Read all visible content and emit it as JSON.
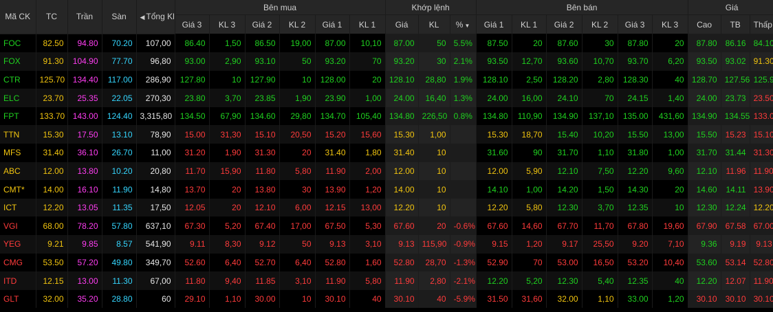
{
  "colors": {
    "up": "#1fd11f",
    "down": "#ff3b3b",
    "ref": "#f1c40f",
    "ceil": "#ff3df2",
    "floor": "#35d6ff",
    "neutral": "#e6e6e6"
  },
  "header": {
    "groups": {
      "buy": "Bên mua",
      "match": "Khớp lệnh",
      "sell": "Bên bán",
      "price": "Giá"
    },
    "cols": {
      "symbol": "Mã CK",
      "ref": "TC",
      "ceil": "Trần",
      "floor": "Sàn",
      "total": "Tổng Kl",
      "buy": [
        "Giá 3",
        "KL 3",
        "Giá 2",
        "KL 2",
        "Giá 1",
        "KL 1"
      ],
      "match": [
        "Giá",
        "KL",
        "%"
      ],
      "sell": [
        "Giá 1",
        "KL 1",
        "Giá 2",
        "KL 2",
        "Giá 3",
        "KL 3"
      ],
      "price": [
        "Cao",
        "TB",
        "Thấp"
      ]
    }
  },
  "rows": [
    {
      "sym": "FOC",
      "ref": "82.50",
      "ceil": "94.80",
      "floor": "70.20",
      "total": "107,00",
      "b3p": "86.40",
      "b3v": "1,50",
      "b2p": "86.50",
      "b2v": "19,00",
      "b1p": "87.00",
      "b1v": "10,10",
      "mp": "87.00",
      "mv": "50",
      "pct": "5.5%",
      "s1p": "87.50",
      "s1v": "20",
      "s2p": "87.60",
      "s2v": "30",
      "s3p": "87.80",
      "s3v": "20",
      "hi": "87.80",
      "avg": "86.16",
      "lo": "84.10",
      "c": {
        "sym": "u",
        "b3": "u",
        "b2": "u",
        "b1": "u",
        "m": "u",
        "s1": "u",
        "s2": "u",
        "s3": "u",
        "hi": "u",
        "avg": "u",
        "lo": "u"
      }
    },
    {
      "sym": "FOX",
      "ref": "91.30",
      "ceil": "104.90",
      "floor": "77.70",
      "total": "96,80",
      "b3p": "93.00",
      "b3v": "2,90",
      "b2p": "93.10",
      "b2v": "50",
      "b1p": "93.20",
      "b1v": "70",
      "mp": "93.20",
      "mv": "30",
      "pct": "2.1%",
      "s1p": "93.50",
      "s1v": "12,70",
      "s2p": "93.60",
      "s2v": "10,70",
      "s3p": "93.70",
      "s3v": "6,20",
      "hi": "93.50",
      "avg": "93.02",
      "lo": "91.30",
      "c": {
        "sym": "u",
        "b3": "u",
        "b2": "u",
        "b1": "u",
        "m": "u",
        "s1": "u",
        "s2": "u",
        "s3": "u",
        "hi": "u",
        "avg": "u",
        "lo": "r"
      }
    },
    {
      "sym": "CTR",
      "ref": "125.70",
      "ceil": "134.40",
      "floor": "117.00",
      "total": "286,90",
      "b3p": "127.80",
      "b3v": "10",
      "b2p": "127.90",
      "b2v": "10",
      "b1p": "128.00",
      "b1v": "20",
      "mp": "128.10",
      "mv": "28,80",
      "pct": "1.9%",
      "s1p": "128.10",
      "s1v": "2,50",
      "s2p": "128.20",
      "s2v": "2,80",
      "s3p": "128.30",
      "s3v": "40",
      "hi": "128.70",
      "avg": "127.56",
      "lo": "125.90",
      "c": {
        "sym": "u",
        "b3": "u",
        "b2": "u",
        "b1": "u",
        "m": "u",
        "s1": "u",
        "s2": "u",
        "s3": "u",
        "hi": "u",
        "avg": "u",
        "lo": "u"
      }
    },
    {
      "sym": "ELC",
      "ref": "23.70",
      "ceil": "25.35",
      "floor": "22.05",
      "total": "270,30",
      "b3p": "23.80",
      "b3v": "3,70",
      "b2p": "23.85",
      "b2v": "1,90",
      "b1p": "23.90",
      "b1v": "1,00",
      "mp": "24.00",
      "mv": "16,40",
      "pct": "1.3%",
      "s1p": "24.00",
      "s1v": "16,00",
      "s2p": "24.10",
      "s2v": "70",
      "s3p": "24.15",
      "s3v": "1,40",
      "hi": "24.00",
      "avg": "23.73",
      "lo": "23.50",
      "c": {
        "sym": "u",
        "b3": "u",
        "b2": "u",
        "b1": "u",
        "m": "u",
        "s1": "u",
        "s2": "u",
        "s3": "u",
        "hi": "u",
        "avg": "u",
        "lo": "d"
      }
    },
    {
      "sym": "FPT",
      "ref": "133.70",
      "ceil": "143.00",
      "floor": "124.40",
      "total": "3,315,80",
      "b3p": "134.50",
      "b3v": "67,90",
      "b2p": "134.60",
      "b2v": "29,80",
      "b1p": "134.70",
      "b1v": "105,40",
      "mp": "134.80",
      "mv": "226,50",
      "pct": "0.8%",
      "s1p": "134.80",
      "s1v": "110,90",
      "s2p": "134.90",
      "s2v": "137,10",
      "s3p": "135.00",
      "s3v": "431,60",
      "hi": "134.90",
      "avg": "134.55",
      "lo": "133.00",
      "c": {
        "sym": "u",
        "b3": "u",
        "b2": "u",
        "b1": "u",
        "m": "u",
        "s1": "u",
        "s2": "u",
        "s3": "u",
        "hi": "u",
        "avg": "u",
        "lo": "d"
      }
    },
    {
      "sym": "TTN",
      "ref": "15.30",
      "ceil": "17.50",
      "floor": "13.10",
      "total": "78,90",
      "b3p": "15.00",
      "b3v": "31,30",
      "b2p": "15.10",
      "b2v": "20,50",
      "b1p": "15.20",
      "b1v": "15,60",
      "mp": "15.30",
      "mv": "1,00",
      "pct": "",
      "s1p": "15.30",
      "s1v": "18,70",
      "s2p": "15.40",
      "s2v": "10,20",
      "s3p": "15.50",
      "s3v": "13,00",
      "hi": "15.50",
      "avg": "15.23",
      "lo": "15.10",
      "c": {
        "sym": "r",
        "b3": "d",
        "b2": "d",
        "b1": "d",
        "m": "r",
        "s1": "r",
        "s2": "u",
        "s3": "u",
        "hi": "u",
        "avg": "d",
        "lo": "d"
      }
    },
    {
      "sym": "MFS",
      "ref": "31.40",
      "ceil": "36.10",
      "floor": "26.70",
      "total": "11,00",
      "b3p": "31.20",
      "b3v": "1,90",
      "b2p": "31.30",
      "b2v": "20",
      "b1p": "31.40",
      "b1v": "1,80",
      "mp": "31.40",
      "mv": "10",
      "pct": "",
      "s1p": "31.60",
      "s1v": "90",
      "s2p": "31.70",
      "s2v": "1,10",
      "s3p": "31.80",
      "s3v": "1,00",
      "hi": "31.70",
      "avg": "31.44",
      "lo": "31.30",
      "c": {
        "sym": "r",
        "b3": "d",
        "b2": "d",
        "b1": "r",
        "m": "r",
        "s1": "u",
        "s2": "u",
        "s3": "u",
        "hi": "u",
        "avg": "u",
        "lo": "d"
      }
    },
    {
      "sym": "ABC",
      "ref": "12.00",
      "ceil": "13.80",
      "floor": "10.20",
      "total": "20,80",
      "b3p": "11.70",
      "b3v": "15,90",
      "b2p": "11.80",
      "b2v": "5,80",
      "b1p": "11.90",
      "b1v": "2,00",
      "mp": "12.00",
      "mv": "10",
      "pct": "",
      "s1p": "12.00",
      "s1v": "5,90",
      "s2p": "12.10",
      "s2v": "7,50",
      "s3p": "12.20",
      "s3v": "9,60",
      "hi": "12.10",
      "avg": "11.96",
      "lo": "11.90",
      "c": {
        "sym": "r",
        "b3": "d",
        "b2": "d",
        "b1": "d",
        "m": "r",
        "s1": "r",
        "s2": "u",
        "s3": "u",
        "hi": "u",
        "avg": "d",
        "lo": "d"
      }
    },
    {
      "sym": "CMT*",
      "ref": "14.00",
      "ceil": "16.10",
      "floor": "11.90",
      "total": "14,80",
      "b3p": "13.70",
      "b3v": "20",
      "b2p": "13.80",
      "b2v": "30",
      "b1p": "13.90",
      "b1v": "1,20",
      "mp": "14.00",
      "mv": "10",
      "pct": "",
      "s1p": "14.10",
      "s1v": "1,00",
      "s2p": "14.20",
      "s2v": "1,50",
      "s3p": "14.30",
      "s3v": "20",
      "hi": "14.60",
      "avg": "14.11",
      "lo": "13.90",
      "c": {
        "sym": "r",
        "b3": "d",
        "b2": "d",
        "b1": "d",
        "m": "r",
        "s1": "u",
        "s2": "u",
        "s3": "u",
        "hi": "u",
        "avg": "u",
        "lo": "d"
      }
    },
    {
      "sym": "ICT",
      "ref": "12.20",
      "ceil": "13.05",
      "floor": "11.35",
      "total": "17,50",
      "b3p": "12.05",
      "b3v": "20",
      "b2p": "12.10",
      "b2v": "6,00",
      "b1p": "12.15",
      "b1v": "13,00",
      "mp": "12.20",
      "mv": "10",
      "pct": "",
      "s1p": "12.20",
      "s1v": "5,80",
      "s2p": "12.30",
      "s2v": "3,70",
      "s3p": "12.35",
      "s3v": "10",
      "hi": "12.30",
      "avg": "12.24",
      "lo": "12.20",
      "c": {
        "sym": "r",
        "b3": "d",
        "b2": "d",
        "b1": "d",
        "m": "r",
        "s1": "r",
        "s2": "u",
        "s3": "u",
        "hi": "u",
        "avg": "u",
        "lo": "r"
      }
    },
    {
      "sym": "VGI",
      "ref": "68.00",
      "ceil": "78.20",
      "floor": "57.80",
      "total": "637,10",
      "b3p": "67.30",
      "b3v": "5,20",
      "b2p": "67.40",
      "b2v": "17,00",
      "b1p": "67.50",
      "b1v": "5,30",
      "mp": "67.60",
      "mv": "20",
      "pct": "-0.6%",
      "s1p": "67.60",
      "s1v": "14,60",
      "s2p": "67.70",
      "s2v": "11,70",
      "s3p": "67.80",
      "s3v": "19,60",
      "hi": "67.90",
      "avg": "67.58",
      "lo": "67.00",
      "c": {
        "sym": "d",
        "b3": "d",
        "b2": "d",
        "b1": "d",
        "m": "d",
        "s1": "d",
        "s2": "d",
        "s3": "d",
        "hi": "d",
        "avg": "d",
        "lo": "d"
      }
    },
    {
      "sym": "YEG",
      "ref": "9.21",
      "ceil": "9.85",
      "floor": "8.57",
      "total": "541,90",
      "b3p": "9.11",
      "b3v": "8,30",
      "b2p": "9.12",
      "b2v": "50",
      "b1p": "9.13",
      "b1v": "3,10",
      "mp": "9.13",
      "mv": "115,90",
      "pct": "-0.9%",
      "s1p": "9.15",
      "s1v": "1,20",
      "s2p": "9.17",
      "s2v": "25,50",
      "s3p": "9.20",
      "s3v": "7,10",
      "hi": "9.36",
      "avg": "9.19",
      "lo": "9.13",
      "c": {
        "sym": "d",
        "b3": "d",
        "b2": "d",
        "b1": "d",
        "m": "d",
        "s1": "d",
        "s2": "d",
        "s3": "d",
        "hi": "u",
        "avg": "d",
        "lo": "d"
      }
    },
    {
      "sym": "CMG",
      "ref": "53.50",
      "ceil": "57.20",
      "floor": "49.80",
      "total": "349,70",
      "b3p": "52.60",
      "b3v": "6,40",
      "b2p": "52.70",
      "b2v": "6,40",
      "b1p": "52.80",
      "b1v": "1,60",
      "mp": "52.80",
      "mv": "28,70",
      "pct": "-1.3%",
      "s1p": "52.90",
      "s1v": "70",
      "s2p": "53.00",
      "s2v": "16,50",
      "s3p": "53.20",
      "s3v": "10,40",
      "hi": "53.60",
      "avg": "53.14",
      "lo": "52.80",
      "c": {
        "sym": "d",
        "b3": "d",
        "b2": "d",
        "b1": "d",
        "m": "d",
        "s1": "d",
        "s2": "d",
        "s3": "d",
        "hi": "u",
        "avg": "d",
        "lo": "d"
      }
    },
    {
      "sym": "ITD",
      "ref": "12.15",
      "ceil": "13.00",
      "floor": "11.30",
      "total": "67,00",
      "b3p": "11.80",
      "b3v": "9,40",
      "b2p": "11.85",
      "b2v": "3,10",
      "b1p": "11.90",
      "b1v": "5,80",
      "mp": "11.90",
      "mv": "2,80",
      "pct": "-2.1%",
      "s1p": "12.20",
      "s1v": "5,20",
      "s2p": "12.30",
      "s2v": "5,40",
      "s3p": "12.35",
      "s3v": "40",
      "hi": "12.20",
      "avg": "12.07",
      "lo": "11.90",
      "c": {
        "sym": "d",
        "b3": "d",
        "b2": "d",
        "b1": "d",
        "m": "d",
        "s1": "u",
        "s2": "u",
        "s3": "u",
        "hi": "u",
        "avg": "d",
        "lo": "d"
      }
    },
    {
      "sym": "GLT",
      "ref": "32.00",
      "ceil": "35.20",
      "floor": "28.80",
      "total": "60",
      "b3p": "29.10",
      "b3v": "1,10",
      "b2p": "30.00",
      "b2v": "10",
      "b1p": "30.10",
      "b1v": "40",
      "mp": "30.10",
      "mv": "40",
      "pct": "-5.9%",
      "s1p": "31.50",
      "s1v": "31,60",
      "s2p": "32.00",
      "s2v": "1,10",
      "s3p": "33.00",
      "s3v": "1,20",
      "hi": "30.10",
      "avg": "30.10",
      "lo": "30.10",
      "c": {
        "sym": "d",
        "b3": "d",
        "b2": "d",
        "b1": "d",
        "m": "d",
        "s1": "d",
        "s2": "r",
        "s3": "u",
        "hi": "d",
        "avg": "d",
        "lo": "d"
      }
    }
  ]
}
